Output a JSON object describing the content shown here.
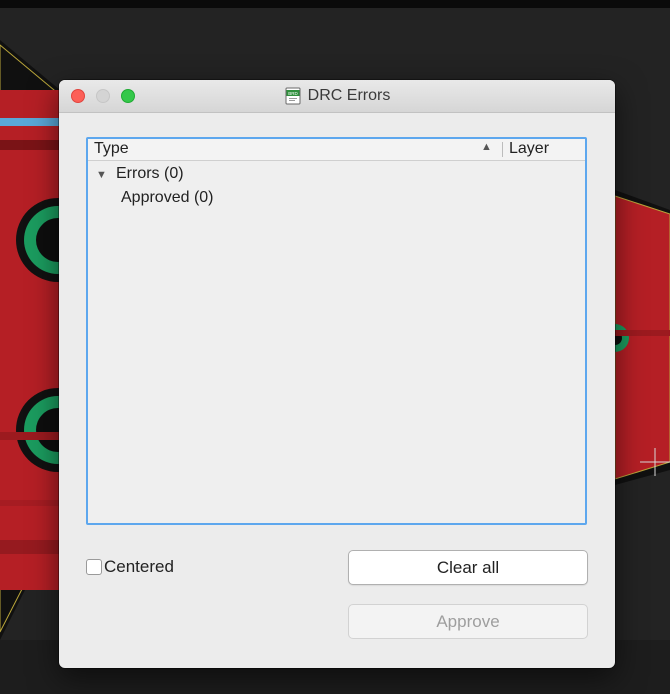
{
  "window": {
    "title": "DRC Errors",
    "title_icon_text": "BRD"
  },
  "tree": {
    "columns": [
      {
        "label": "Type"
      },
      {
        "label": "Layer"
      }
    ],
    "rows": [
      {
        "label": "Errors (0)",
        "expanded": true
      },
      {
        "label": "Approved (0)"
      }
    ]
  },
  "controls": {
    "centered_label": "Centered",
    "centered_checked": false,
    "clear_all_label": "Clear all",
    "approve_label": "Approve",
    "approve_enabled": false
  },
  "colors": {
    "focus_border": "#5da7ee",
    "close": "#fc5f57",
    "zoom": "#34c84a",
    "pcb_copper": "#c2262b",
    "pcb_pad": "#1b9c5f"
  }
}
